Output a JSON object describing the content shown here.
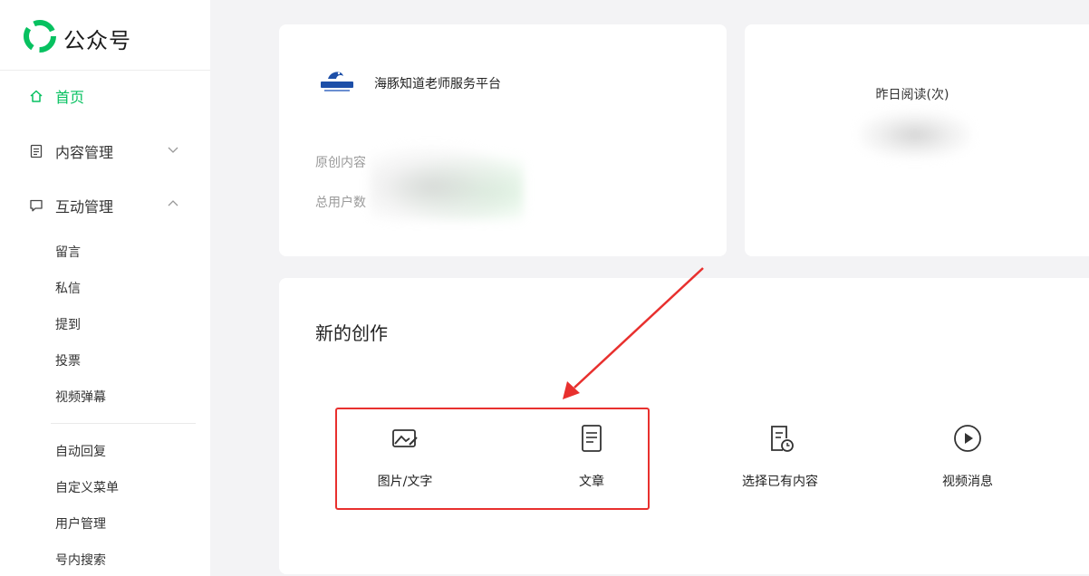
{
  "app": {
    "title": "公众号"
  },
  "sidebar": {
    "home": "首页",
    "content_mgmt": "内容管理",
    "interaction_mgmt": "互动管理",
    "sub_items": [
      "留言",
      "私信",
      "提到",
      "投票",
      "视频弹幕",
      "自动回复",
      "自定义菜单",
      "用户管理",
      "号内搜索"
    ]
  },
  "account": {
    "name": "海豚知道老师服务平台",
    "original_content_label": "原创内容",
    "total_users_label": "总用户数"
  },
  "stats": {
    "yesterday_reads_label": "昨日阅读(次)"
  },
  "create": {
    "title": "新的创作",
    "items": [
      "图片/文字",
      "文章",
      "选择已有内容",
      "视频消息"
    ]
  },
  "colors": {
    "accent": "#07c160",
    "annotation": "#e8302e"
  },
  "icons": {
    "brand": "wechat-mp-logo-icon",
    "home": "home-icon",
    "content": "document-icon",
    "interaction": "chat-bubble-icon",
    "image_text": "image-edit-icon",
    "article": "article-icon",
    "existing": "document-clock-icon",
    "video": "play-circle-icon"
  }
}
